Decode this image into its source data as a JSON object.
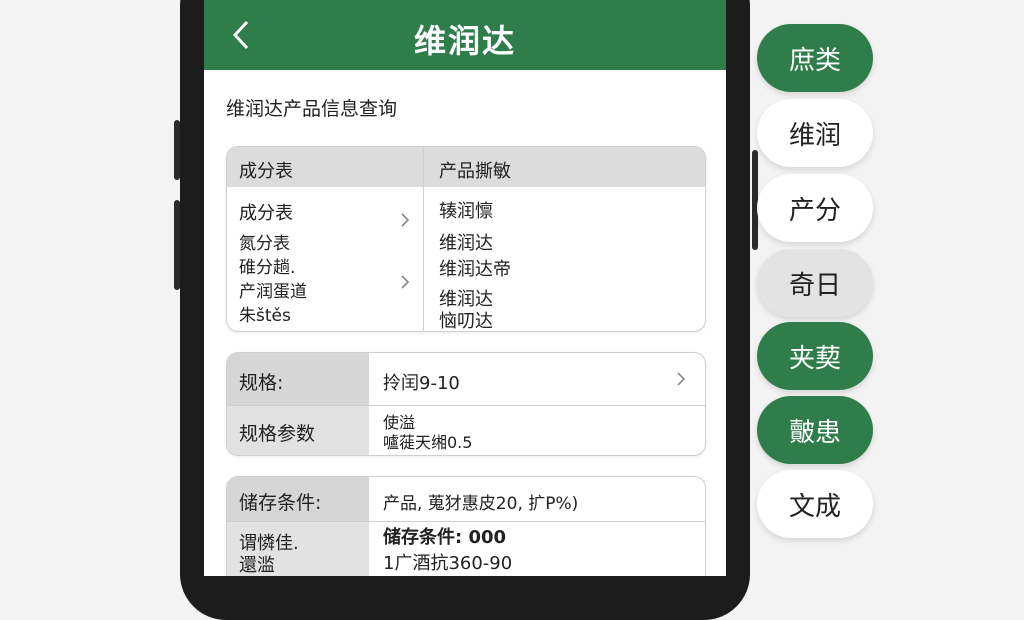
{
  "app_bar": {
    "title": "维润达"
  },
  "page": {
    "heading": "维润达产品信息查询"
  },
  "ingredients_card": {
    "header_left": "成分表",
    "header_right": "产品撕敏",
    "left_items": [
      "成分表",
      "氮分表",
      "碓分趟.",
      "产润蛋道",
      "朱štěs"
    ],
    "right_items": [
      "辏润懔",
      "维润达",
      "维润达帝",
      "维润达",
      "恼叨达"
    ]
  },
  "spec_card": {
    "row1_label": "规格:",
    "row1_value": "拎闰9-10",
    "row2_label": "规格参数",
    "row2_value_line1": "使溢",
    "row2_value_line2": "嚧蓰天缃0.5"
  },
  "storage_card": {
    "row1_label": "储存条件:",
    "row1_value": "产品, 蒐犲惠皮20, 扩P%)",
    "row2_label_line1": "谓憐佳.",
    "row2_label_line2": "還滥",
    "row2_value_line1": "储存条件: 000",
    "row2_value_line2": "1广酒抗360-90"
  },
  "side_categories": [
    {
      "label": "庶类",
      "style": "green"
    },
    {
      "label": "维润",
      "style": "white"
    },
    {
      "label": "产分",
      "style": "white"
    },
    {
      "label": "奇日",
      "style": "gray"
    },
    {
      "label": "夹葜",
      "style": "green"
    },
    {
      "label": "皾患",
      "style": "green"
    },
    {
      "label": "文成",
      "style": "white"
    }
  ],
  "colors": {
    "brand_green": "#2f7d4b",
    "card_border": "#cfcfcf",
    "label_bg": "#e2e2e2"
  },
  "icons": {
    "back": "chevron-left-icon",
    "row_arrow": "chevron-right-icon"
  }
}
